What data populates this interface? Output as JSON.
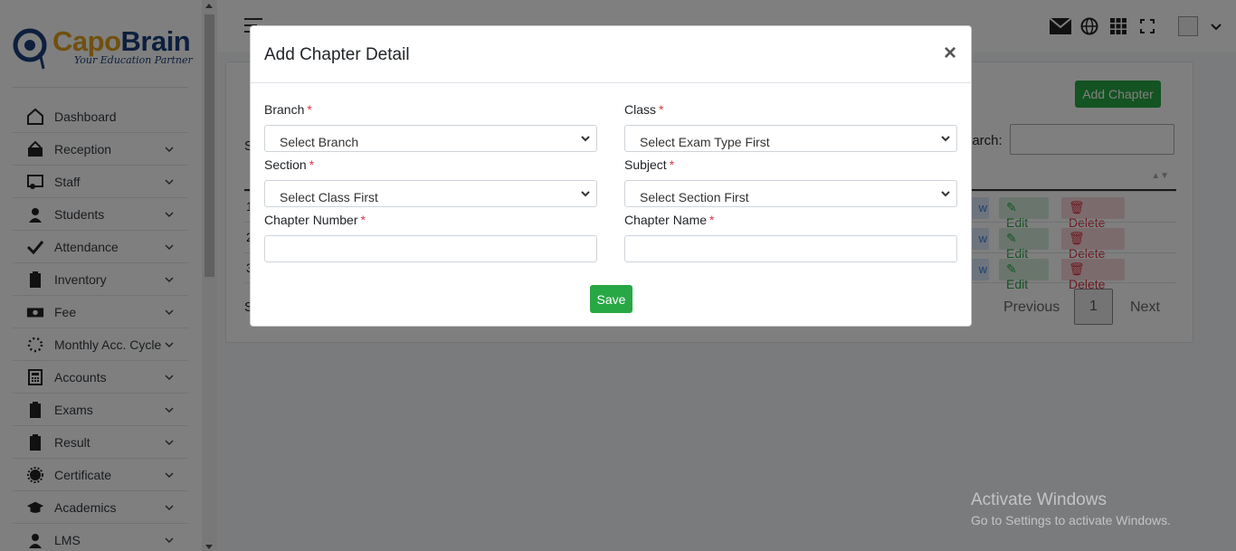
{
  "brand": {
    "name_part1": "Capo",
    "name_part2": "Brain",
    "tagline": "Your Education Partner"
  },
  "sidebar": {
    "items": [
      {
        "label": "Dashboard",
        "icon": "home-icon"
      },
      {
        "label": "Reception",
        "icon": "reception-icon"
      },
      {
        "label": "Staff",
        "icon": "staff-icon"
      },
      {
        "label": "Students",
        "icon": "student-icon"
      },
      {
        "label": "Attendance",
        "icon": "check-icon"
      },
      {
        "label": "Inventory",
        "icon": "clipboard-icon"
      },
      {
        "label": "Fee",
        "icon": "money-icon"
      },
      {
        "label": "Monthly Acc. Cycle",
        "icon": "cycle-icon"
      },
      {
        "label": "Accounts",
        "icon": "calculator-icon"
      },
      {
        "label": "Exams",
        "icon": "clipboard-icon"
      },
      {
        "label": "Result",
        "icon": "clipboard-icon"
      },
      {
        "label": "Certificate",
        "icon": "certificate-icon"
      },
      {
        "label": "Academics",
        "icon": "graduation-cap-icon"
      },
      {
        "label": "LMS",
        "icon": "student-icon"
      }
    ]
  },
  "topbar": {
    "icons": [
      "mail-icon",
      "globe-icon",
      "apps-grid-icon",
      "fullscreen-icon",
      "avatar",
      "chevron-down-icon"
    ]
  },
  "content": {
    "add_button": "Add Chapter",
    "show_text": "S",
    "search_label": "earch:",
    "rows": [
      {
        "num": "1",
        "view": "w",
        "edit": "Edit",
        "delete": "Delete"
      },
      {
        "num": "2",
        "view": "w",
        "edit": "Edit",
        "delete": "Delete"
      },
      {
        "num": "3",
        "view": "w",
        "edit": "Edit",
        "delete": "Delete"
      }
    ],
    "footer_text": "S",
    "pagination": {
      "previous": "Previous",
      "current": "1",
      "next": "Next"
    }
  },
  "modal": {
    "title": "Add Chapter Detail",
    "close": "×",
    "branch": {
      "label": "Branch",
      "value": "Select Branch"
    },
    "class": {
      "label": "Class",
      "value": "Select Exam Type First"
    },
    "section": {
      "label": "Section",
      "value": "Select Class First"
    },
    "subject": {
      "label": "Subject",
      "value": "Select Section First"
    },
    "chapter_number": {
      "label": "Chapter Number",
      "value": ""
    },
    "chapter_name": {
      "label": "Chapter Name",
      "value": ""
    },
    "required_mark": "*",
    "save": "Save"
  },
  "watermark": {
    "line1": "Activate Windows",
    "line2": "Go to Settings to activate Windows."
  },
  "colors": {
    "primary_green": "#28a745",
    "danger": "#dc3545",
    "brand_gold": "#e0a020",
    "brand_navy": "#1b3f7a"
  }
}
